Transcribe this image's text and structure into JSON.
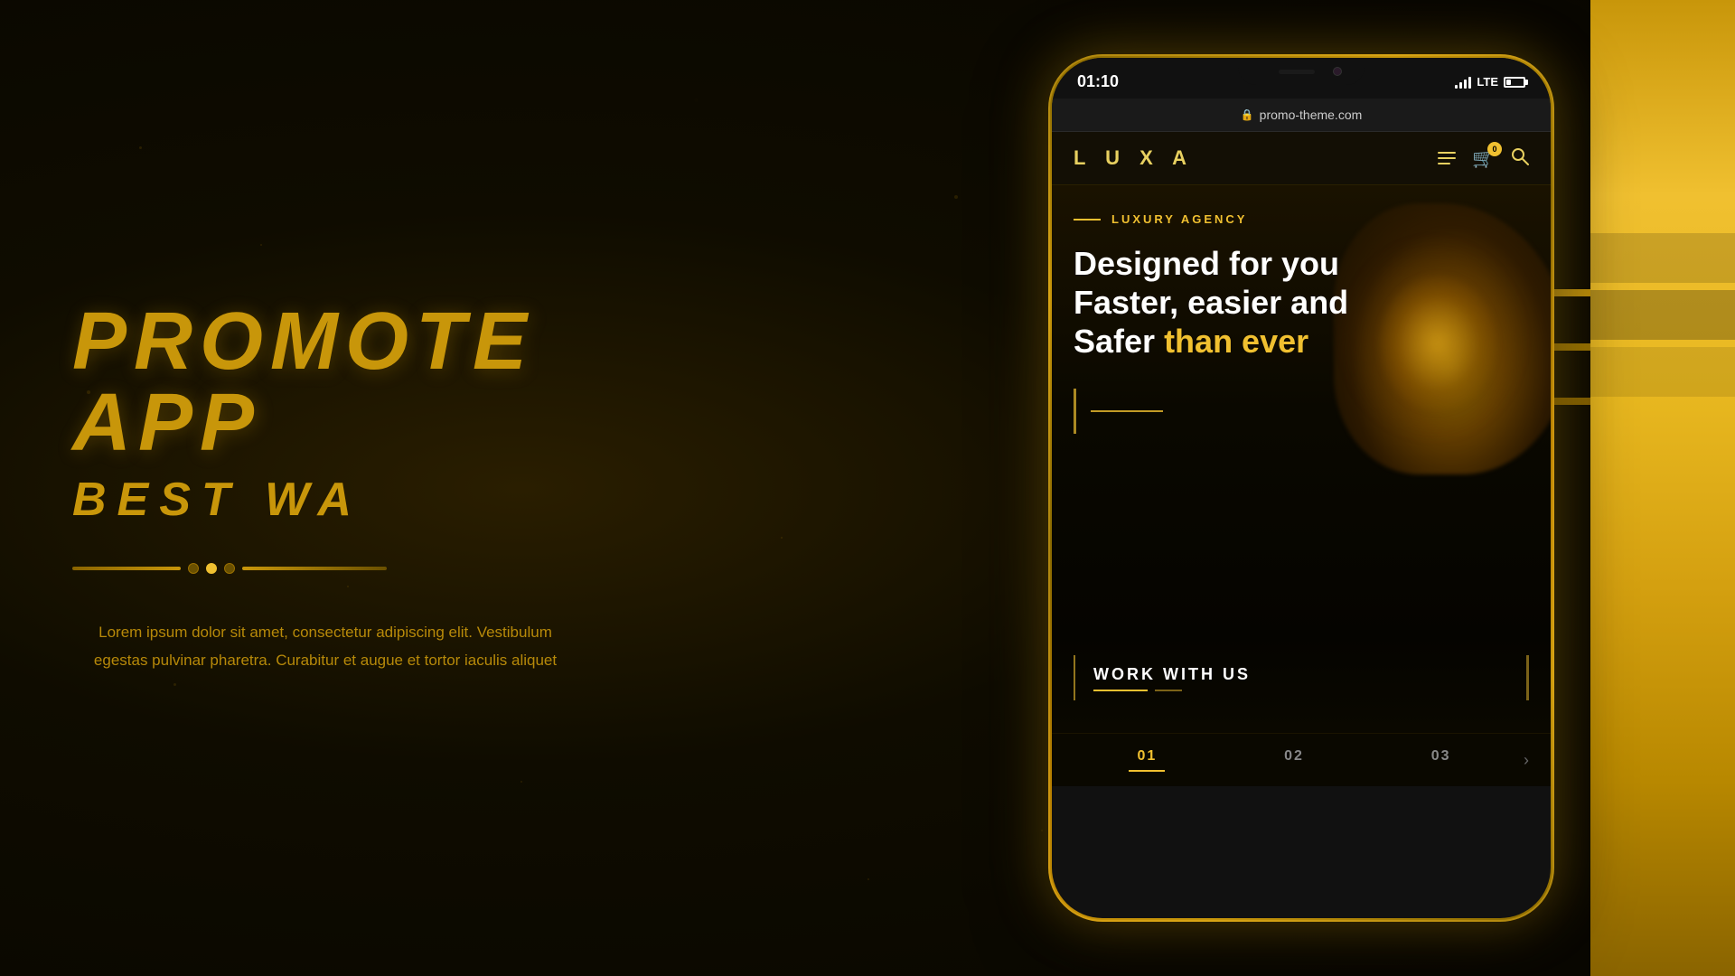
{
  "background": {
    "color": "#1a1200"
  },
  "left_content": {
    "main_title": "PROMOTE APP",
    "sub_title": "BEST WA",
    "description": "Lorem ipsum dolor sit amet, consectetur adipiscing elit. Vestibulum egestas pulvinar pharetra. Curabitur et augue et tortor iaculis aliquet",
    "slider": {
      "dots": [
        {
          "state": "inactive"
        },
        {
          "state": "active"
        },
        {
          "state": "inactive"
        }
      ]
    }
  },
  "phone": {
    "status_bar": {
      "time": "01:10",
      "signal": "signal",
      "lte": "LTE",
      "battery": "battery"
    },
    "browser": {
      "url": "promo-theme.com",
      "lock": "🔒"
    },
    "navbar": {
      "logo": "L U X A",
      "cart_count": "0"
    },
    "hero": {
      "label": "LUXURY AGENCY",
      "headline_line1": "Designed for you",
      "headline_line2": "Faster, easier and",
      "headline_line3_normal": "Safer ",
      "headline_line3_highlight": "than ever"
    },
    "work_section": {
      "title": "WORK WITH US"
    },
    "tabs": {
      "items": [
        {
          "label": "01",
          "active": true
        },
        {
          "label": "02",
          "active": false
        },
        {
          "label": "03",
          "active": false
        }
      ],
      "next_icon": "›"
    }
  }
}
